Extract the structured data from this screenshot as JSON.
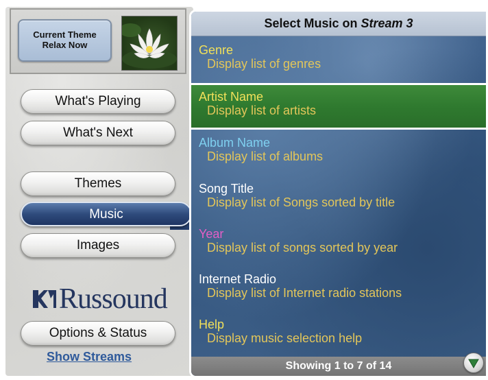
{
  "theme": {
    "line1": "Current Theme",
    "line2": "Relax Now"
  },
  "nav": {
    "whats_playing": "What's Playing",
    "whats_next": "What's Next",
    "themes": "Themes",
    "music": "Music",
    "images": "Images",
    "options_status": "Options & Status",
    "active": "Music"
  },
  "logo": {
    "text": "Russound"
  },
  "show_streams": "Show Streams",
  "header": {
    "prefix": "Select Music on ",
    "stream": "Stream 3"
  },
  "items": [
    {
      "title": "Genre",
      "desc": "Display list of genres",
      "title_color": "#f1e05a"
    },
    {
      "title": "Artist Name",
      "desc": "Display list of artists",
      "title_color": "#f1e05a",
      "selected": true
    },
    {
      "title": "Album Name",
      "desc": "Display list of albums",
      "title_color": "#7fd0f0"
    },
    {
      "title": "Song Title",
      "desc": "Display list of Songs sorted by title",
      "title_color": "#ffffff"
    },
    {
      "title": "Year",
      "desc": "Display list of songs sorted by year",
      "title_color": "#e45fc6"
    },
    {
      "title": "Internet Radio",
      "desc": "Display list of Internet radio stations",
      "title_color": "#ffffff"
    },
    {
      "title": "Help",
      "desc": "Display music selection help",
      "title_color": "#f1e05a"
    }
  ],
  "footer": "Showing 1 to 7 of 14",
  "colors": {
    "accent_green": "#2f7a2f",
    "nav_active": "#2f4b7c",
    "desc_text": "#e3c65a"
  },
  "icons": {
    "scroll_down": "down-arrow-icon",
    "flower": "lotus-flower-icon",
    "logo_mark": "russound-logo-icon"
  }
}
